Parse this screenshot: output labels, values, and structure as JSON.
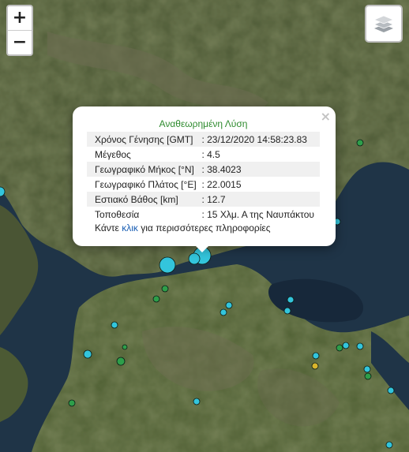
{
  "controls": {
    "zoom_in": "+",
    "zoom_out": "−",
    "layers_icon": "layers-icon"
  },
  "popup": {
    "close": "×",
    "title": "Αναθεωρημένη Λύση",
    "rows": [
      {
        "label": "Χρόνος Γένησης [GMT]",
        "value": ": 23/12/2020 14:58:23.83"
      },
      {
        "label": "Μέγεθος",
        "value": ": 4.5"
      },
      {
        "label": "Γεωγραφικό Μήκος [°N]",
        "value": ": 38.4023"
      },
      {
        "label": "Γεωγραφικό Πλάτος [°E]",
        "value": ": 22.0015"
      },
      {
        "label": "Εστιακό Βάθος [km]",
        "value": ": 12.7"
      },
      {
        "label": "Τοποθεσία",
        "value": ": 15 Χλμ. Α της Ναυπάκτου"
      }
    ],
    "more_prefix": "Κάντε",
    "more_link": "κλικ",
    "more_suffix": "για περισσότερες πληροφορίες"
  },
  "colors": {
    "marker_cyan": "#33c5dc",
    "marker_green": "#2e9e4a",
    "marker_yellow": "#d8b52c",
    "title_green": "#2e8b2e"
  }
}
